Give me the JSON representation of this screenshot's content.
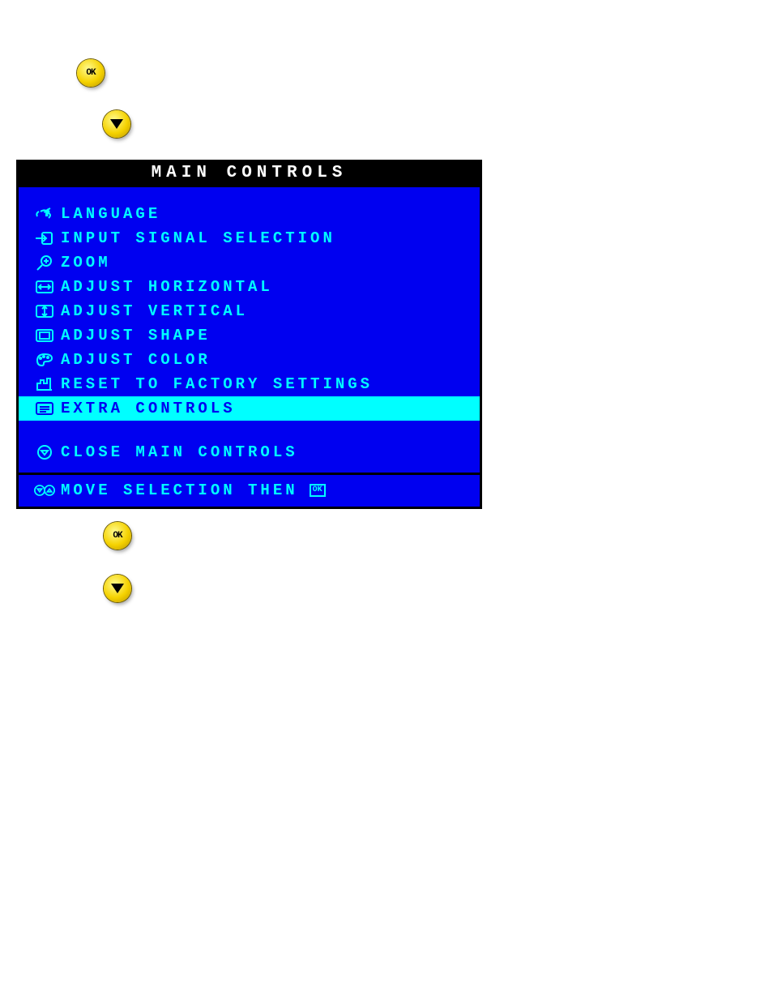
{
  "buttons": {
    "ok_top": "OK",
    "down_top": "down",
    "ok_bottom": "OK",
    "down_bottom": "down"
  },
  "osd": {
    "title": "MAIN CONTROLS",
    "items": [
      {
        "label": "LANGUAGE"
      },
      {
        "label": "INPUT SIGNAL SELECTION"
      },
      {
        "label": "ZOOM"
      },
      {
        "label": "ADJUST HORIZONTAL"
      },
      {
        "label": "ADJUST VERTICAL"
      },
      {
        "label": "ADJUST SHAPE"
      },
      {
        "label": "ADJUST COLOR"
      },
      {
        "label": "RESET TO FACTORY SETTINGS"
      },
      {
        "label": "EXTRA CONTROLS"
      }
    ],
    "close": "CLOSE MAIN CONTROLS",
    "footer": "MOVE SELECTION THEN",
    "footer_ok": "OK",
    "selected_index": 8,
    "colors": {
      "bg": "#0000f0",
      "text": "#00ffff",
      "highlight_bg": "#00ffff",
      "highlight_text": "#0000f0",
      "frame": "#000000"
    }
  }
}
